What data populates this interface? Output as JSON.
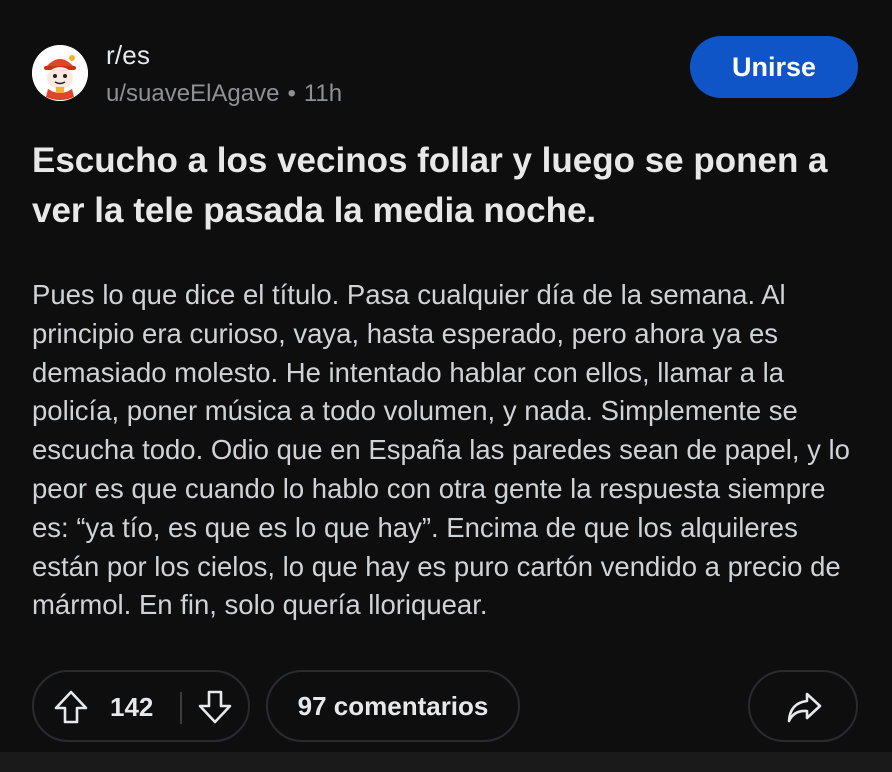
{
  "post": {
    "subreddit": "r/es",
    "author": "u/suaveElAgave",
    "separator": "•",
    "age": "11h",
    "join_label": "Unirse",
    "title": "Escucho a los vecinos follar y luego se ponen a ver la tele pasada la media noche.",
    "body": "Pues lo que dice el título. Pasa cualquier día de la semana. Al principio era curioso, vaya, hasta esperado, pero ahora ya es demasiado molesto. He intentado hablar con ellos, llamar a la policía, poner música a todo volumen, y nada. Simplemente se escucha todo. Odio que en España las paredes sean de papel, y lo peor es que cuando lo hablo con otra gente la respuesta siempre es: “ya tío, es que es lo que hay”. Encima de que los alquileres están por los cielos, lo que hay es puro cartón vendido a precio de mármol. En fin, solo quería lloriquear."
  },
  "actions": {
    "vote_count": "142",
    "comments_label": "97 comentarios"
  },
  "icons": {
    "avatar": "subreddit-avatar-icon",
    "upvote": "upvote-arrow-icon",
    "downvote": "downvote-arrow-icon",
    "share": "share-arrow-icon"
  },
  "colors": {
    "background": "#0e0e0f",
    "join_button": "#0f55c8",
    "text_primary": "#e8e8e8",
    "text_muted": "#8e9194",
    "pill_border": "#2a2b2d"
  }
}
